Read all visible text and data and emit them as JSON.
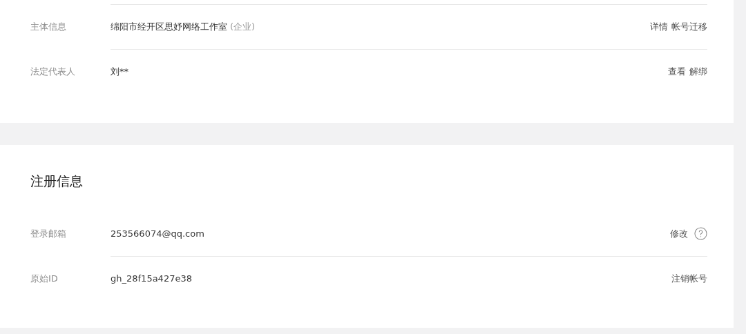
{
  "sections": [
    {
      "rows": [
        {
          "label": "主体信息",
          "value": "绵阳市经开区思妤网络工作室",
          "value_note": "(企业)",
          "actions": [
            "详情",
            "帐号迁移"
          ],
          "help": false
        },
        {
          "label": "法定代表人",
          "value": "刘**",
          "actions": [
            "查看",
            "解绑"
          ],
          "help": false
        }
      ]
    },
    {
      "title": "注册信息",
      "rows": [
        {
          "label": "登录邮箱",
          "value": "253566074@qq.com",
          "actions": [
            "修改"
          ],
          "help": true
        },
        {
          "label": "原始ID",
          "value": "gh_28f15a427e38",
          "actions": [
            "注销帐号"
          ],
          "help": false
        }
      ]
    }
  ]
}
